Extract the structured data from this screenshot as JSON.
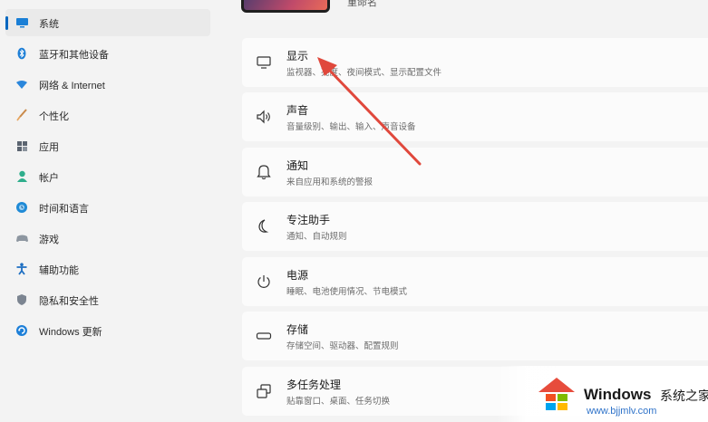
{
  "sidebar": {
    "items": [
      {
        "label": "系统",
        "icon": "monitor-icon",
        "active": true
      },
      {
        "label": "蓝牙和其他设备",
        "icon": "bluetooth-icon"
      },
      {
        "label": "网络 & Internet",
        "icon": "wifi-icon"
      },
      {
        "label": "个性化",
        "icon": "brush-icon"
      },
      {
        "label": "应用",
        "icon": "apps-icon"
      },
      {
        "label": "帐户",
        "icon": "person-icon"
      },
      {
        "label": "时间和语言",
        "icon": "globe-clock-icon"
      },
      {
        "label": "游戏",
        "icon": "gamepad-icon"
      },
      {
        "label": "辅助功能",
        "icon": "accessibility-icon"
      },
      {
        "label": "隐私和安全性",
        "icon": "shield-icon"
      },
      {
        "label": "Windows 更新",
        "icon": "update-icon"
      }
    ]
  },
  "main": {
    "rename_label": "重命名",
    "cards": [
      {
        "title": "显示",
        "subtitle": "监视器、亮度、夜间模式、显示配置文件",
        "icon": "display-icon"
      },
      {
        "title": "声音",
        "subtitle": "音量级别、输出、输入、声音设备",
        "icon": "speaker-icon"
      },
      {
        "title": "通知",
        "subtitle": "来自应用和系统的警报",
        "icon": "bell-icon"
      },
      {
        "title": "专注助手",
        "subtitle": "通知、自动规则",
        "icon": "moon-icon"
      },
      {
        "title": "电源",
        "subtitle": "睡眠、电池使用情况、节电模式",
        "icon": "power-icon"
      },
      {
        "title": "存储",
        "subtitle": "存储空间、驱动器、配置规则",
        "icon": "storage-icon"
      },
      {
        "title": "多任务处理",
        "subtitle": "贴靠窗口、桌面、任务切换",
        "icon": "multitask-icon"
      }
    ]
  },
  "watermark": {
    "brand": "Windows",
    "brand_cn": "系统之家",
    "url": "www.bjjmlv.com"
  },
  "colors": {
    "accent": "#0067c0",
    "annotation_arrow": "#e0483c",
    "background": "#f3f3f3",
    "card": "#fbfbfb"
  }
}
